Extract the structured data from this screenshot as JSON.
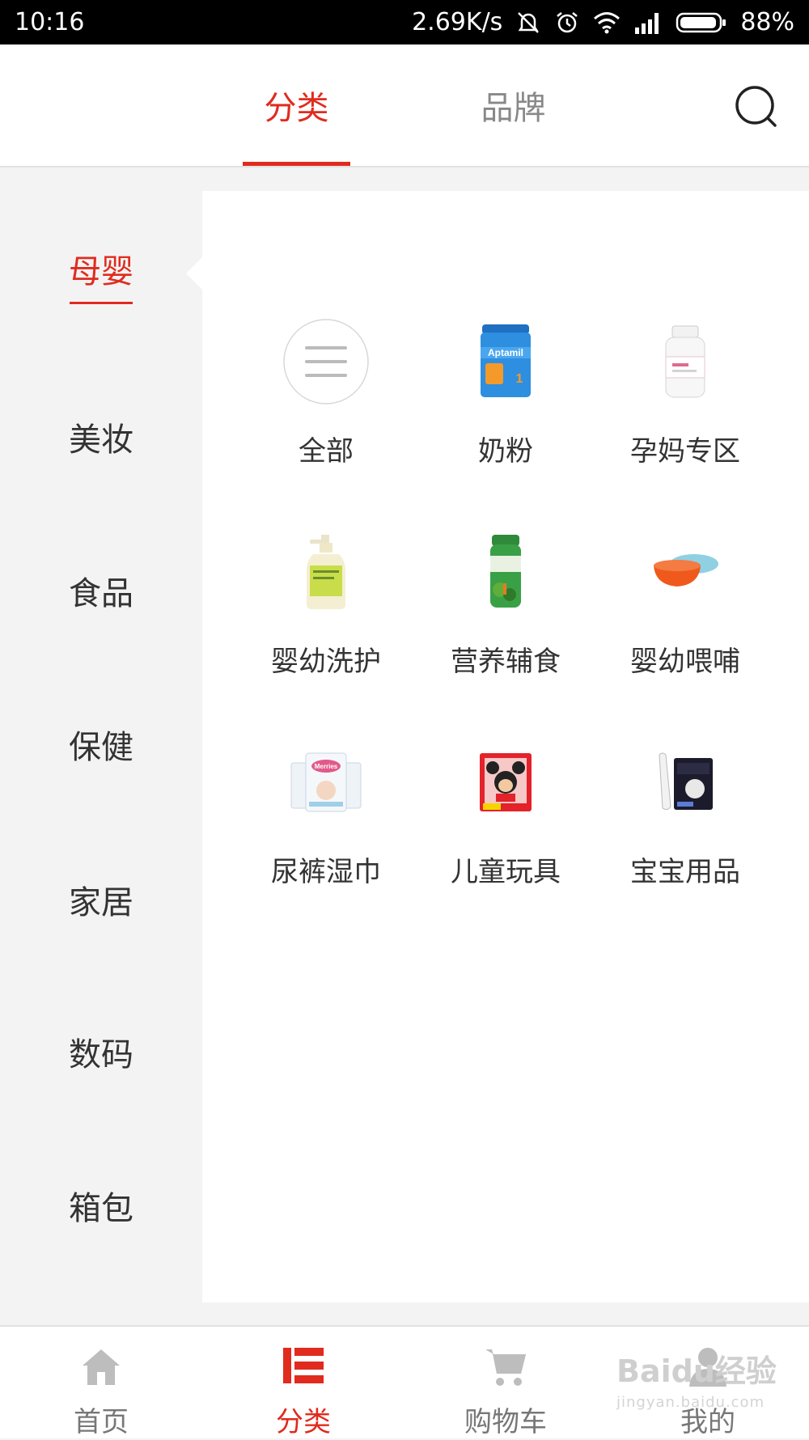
{
  "status_bar": {
    "time": "10:16",
    "speed": "2.69K/s",
    "battery": "88%"
  },
  "header": {
    "tabs": [
      {
        "label": "分类",
        "active": true
      },
      {
        "label": "品牌",
        "active": false
      }
    ],
    "search_icon": "search-icon"
  },
  "sidebar": {
    "items": [
      {
        "label": "母婴",
        "active": true
      },
      {
        "label": "美妆",
        "active": false
      },
      {
        "label": "食品",
        "active": false
      },
      {
        "label": "保健",
        "active": false
      },
      {
        "label": "家居",
        "active": false
      },
      {
        "label": "数码",
        "active": false
      },
      {
        "label": "箱包",
        "active": false
      }
    ]
  },
  "categories": [
    {
      "label": "全部",
      "icon": "menu-lines-icon"
    },
    {
      "label": "奶粉",
      "icon": "milk-powder-can-icon"
    },
    {
      "label": "孕妈专区",
      "icon": "supplement-bottle-icon"
    },
    {
      "label": "婴幼洗护",
      "icon": "lotion-bottle-icon"
    },
    {
      "label": "营养辅食",
      "icon": "baby-food-jar-icon"
    },
    {
      "label": "婴幼喂哺",
      "icon": "feeding-bowl-icon"
    },
    {
      "label": "尿裤湿巾",
      "icon": "diaper-pack-icon"
    },
    {
      "label": "儿童玩具",
      "icon": "toy-box-icon"
    },
    {
      "label": "宝宝用品",
      "icon": "thermometer-box-icon"
    }
  ],
  "bottom_nav": [
    {
      "label": "首页",
      "icon": "home-icon",
      "active": false
    },
    {
      "label": "分类",
      "icon": "category-icon",
      "active": true
    },
    {
      "label": "购物车",
      "icon": "cart-icon",
      "active": false
    },
    {
      "label": "我的",
      "icon": "profile-icon",
      "active": false
    }
  ],
  "watermark": {
    "logo": "Baidu经验",
    "url": "jingyan.baidu.com"
  },
  "colors": {
    "accent": "#e02b1e",
    "text": "#333333",
    "muted": "#888888",
    "sidebar_bg": "#f3f3f3"
  }
}
